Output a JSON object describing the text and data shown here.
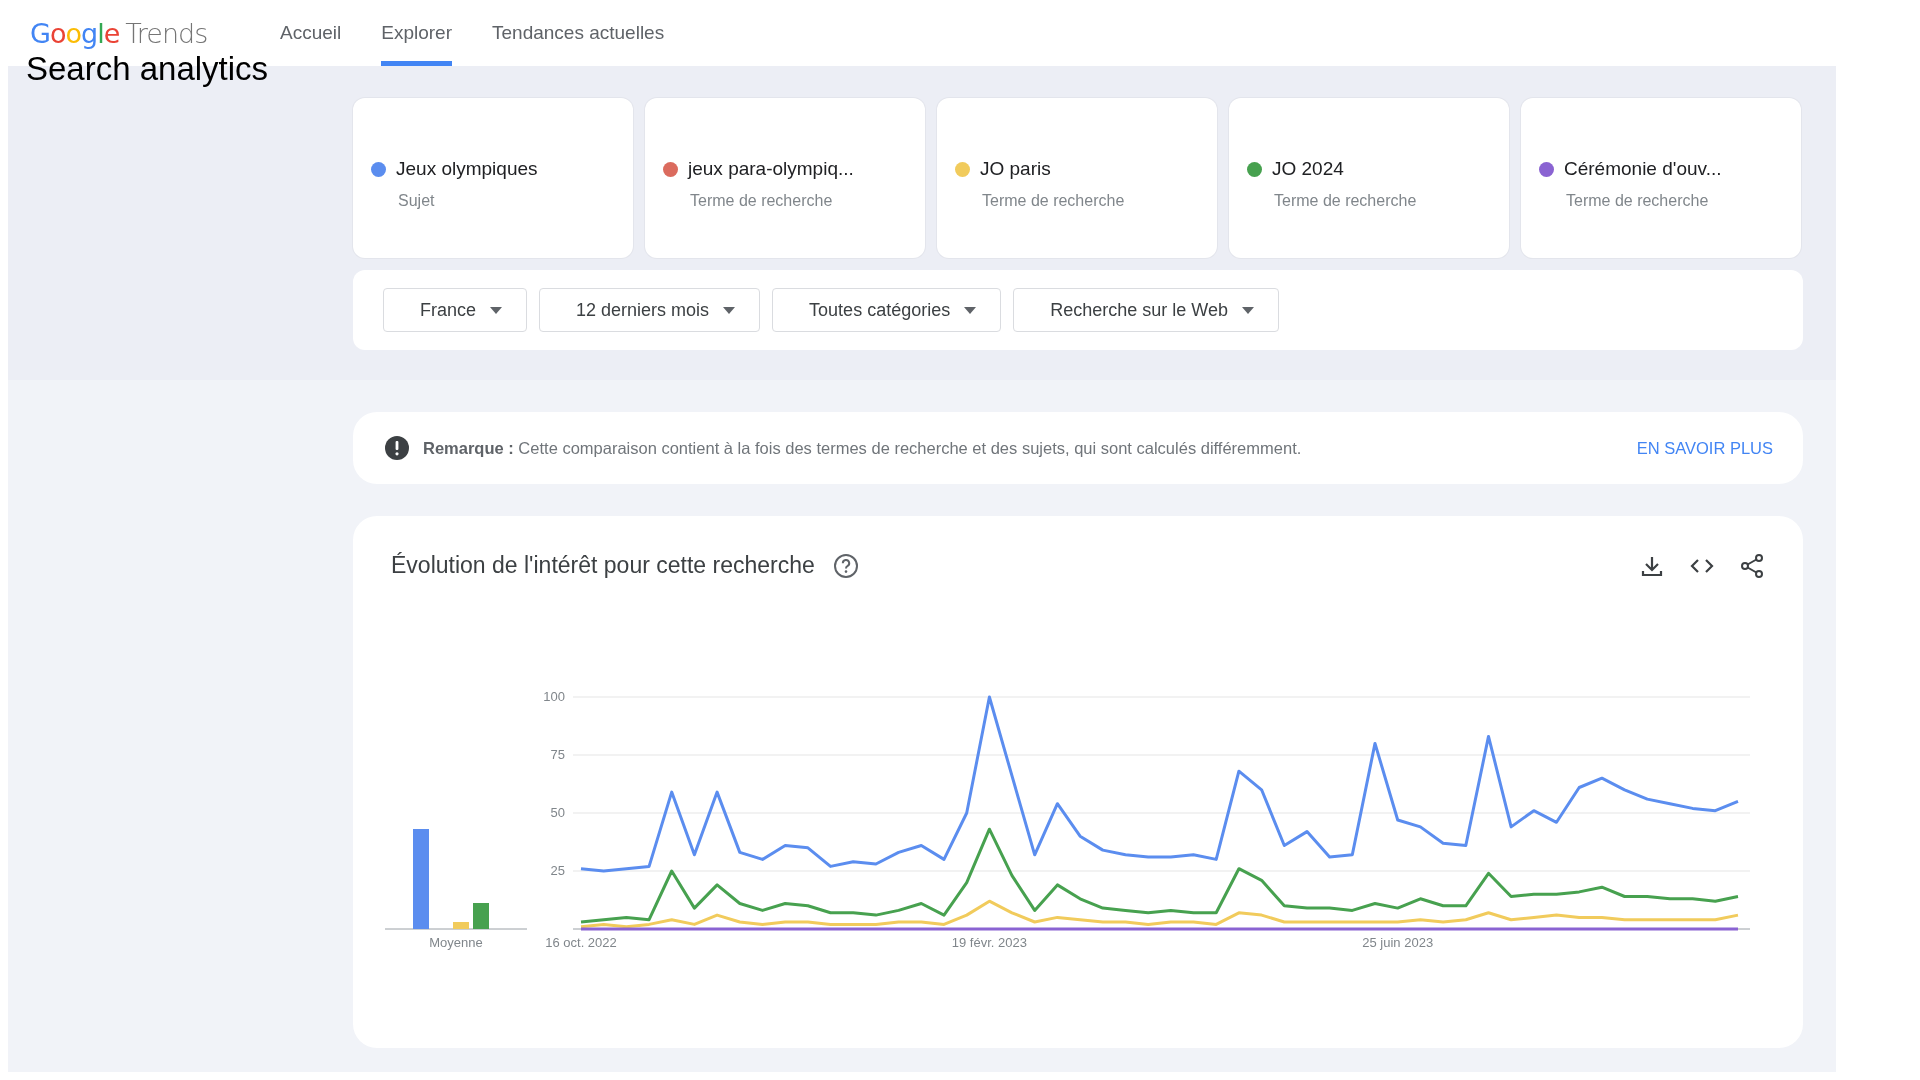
{
  "header": {
    "logo": {
      "brand": "Google",
      "product": "Trends"
    },
    "overlay_title": "Search analytics",
    "tabs": [
      {
        "label": "Accueil",
        "selected": false
      },
      {
        "label": "Explorer",
        "selected": true
      },
      {
        "label": "Tendances actuelles",
        "selected": false
      }
    ]
  },
  "terms": [
    {
      "name": "Jeux olympiques",
      "type": "Sujet",
      "color": "#5b8def"
    },
    {
      "name": "jeux para-olympiq...",
      "type": "Terme de recherche",
      "color": "#db6b5e"
    },
    {
      "name": "JO paris",
      "type": "Terme de recherche",
      "color": "#f1cb5c"
    },
    {
      "name": "JO 2024",
      "type": "Terme de recherche",
      "color": "#47a14f"
    },
    {
      "name": "Cérémonie d'ouv...",
      "type": "Terme de recherche",
      "color": "#8a63d2"
    }
  ],
  "filters": [
    "France",
    "12 derniers mois",
    "Toutes catégories",
    "Recherche sur le Web"
  ],
  "note": {
    "text": "**Remarque :** Cette comparaison contient à la fois des termes de recherche et des sujets, qui sont calculés différemment.",
    "link": "EN SAVOIR PLUS"
  },
  "interest_chart": {
    "title": "Évolution de l'intérêt pour cette recherche",
    "average_label": "Moyenne",
    "timeline": {
      "chart_data": {
        "type": "line",
        "categories": [
          "16 oct. 2022",
          null,
          null,
          null,
          null,
          null,
          null,
          null,
          null,
          null,
          null,
          null,
          null,
          null,
          null,
          null,
          null,
          null,
          "19 févr. 2023",
          null,
          null,
          null,
          null,
          null,
          null,
          null,
          null,
          null,
          null,
          null,
          null,
          null,
          null,
          null,
          null,
          null,
          "25 juin 2023",
          null,
          null,
          null,
          null,
          null,
          null,
          null,
          null,
          null,
          null,
          null,
          null,
          null,
          null,
          null
        ],
        "ylim": [
          0,
          100
        ],
        "yticks": [
          25,
          50,
          75,
          100
        ],
        "grid": true,
        "series": [
          {
            "color": "#5b8def",
            "values": [
              26,
              25,
              26,
              27,
              59,
              32,
              59,
              33,
              30,
              36,
              35,
              27,
              29,
              28,
              33,
              36,
              30,
              50,
              100,
              66,
              32,
              54,
              40,
              34,
              32,
              31,
              31,
              32,
              30,
              68,
              60,
              36,
              42,
              31,
              32,
              80,
              47,
              44,
              37,
              36,
              83,
              44,
              51,
              46,
              61,
              65,
              60,
              56,
              54,
              52,
              51,
              55
            ]
          },
          {
            "color": "#f1cb5c",
            "values": [
              1,
              2,
              1,
              2,
              4,
              2,
              6,
              3,
              2,
              3,
              3,
              2,
              2,
              2,
              3,
              3,
              2,
              6,
              12,
              7,
              3,
              5,
              4,
              3,
              3,
              2,
              3,
              3,
              2,
              7,
              6,
              3,
              3,
              3,
              3,
              3,
              3,
              4,
              3,
              4,
              7,
              4,
              5,
              6,
              5,
              5,
              4,
              4,
              4,
              4,
              4,
              6
            ]
          },
          {
            "color": "#47a14f",
            "values": [
              3,
              4,
              5,
              4,
              25,
              9,
              19,
              11,
              8,
              11,
              10,
              7,
              7,
              6,
              8,
              11,
              6,
              20,
              43,
              23,
              8,
              19,
              13,
              9,
              8,
              7,
              8,
              7,
              7,
              26,
              21,
              10,
              9,
              9,
              8,
              11,
              9,
              13,
              10,
              10,
              24,
              14,
              15,
              15,
              16,
              18,
              14,
              14,
              13,
              13,
              12,
              14
            ]
          },
          {
            "color": "#8a63d2",
            "values": [
              0,
              0,
              0,
              0,
              0,
              0,
              0,
              0,
              0,
              0,
              0,
              0,
              0,
              0,
              0,
              0,
              0,
              0,
              0,
              0,
              0,
              0,
              0,
              0,
              0,
              0,
              0,
              0,
              0,
              0,
              0,
              0,
              0,
              0,
              0,
              0,
              0,
              0,
              0,
              0,
              0,
              0,
              0,
              0,
              0,
              0,
              0,
              0,
              0,
              0,
              0,
              0
            ]
          }
        ]
      }
    }
  }
}
